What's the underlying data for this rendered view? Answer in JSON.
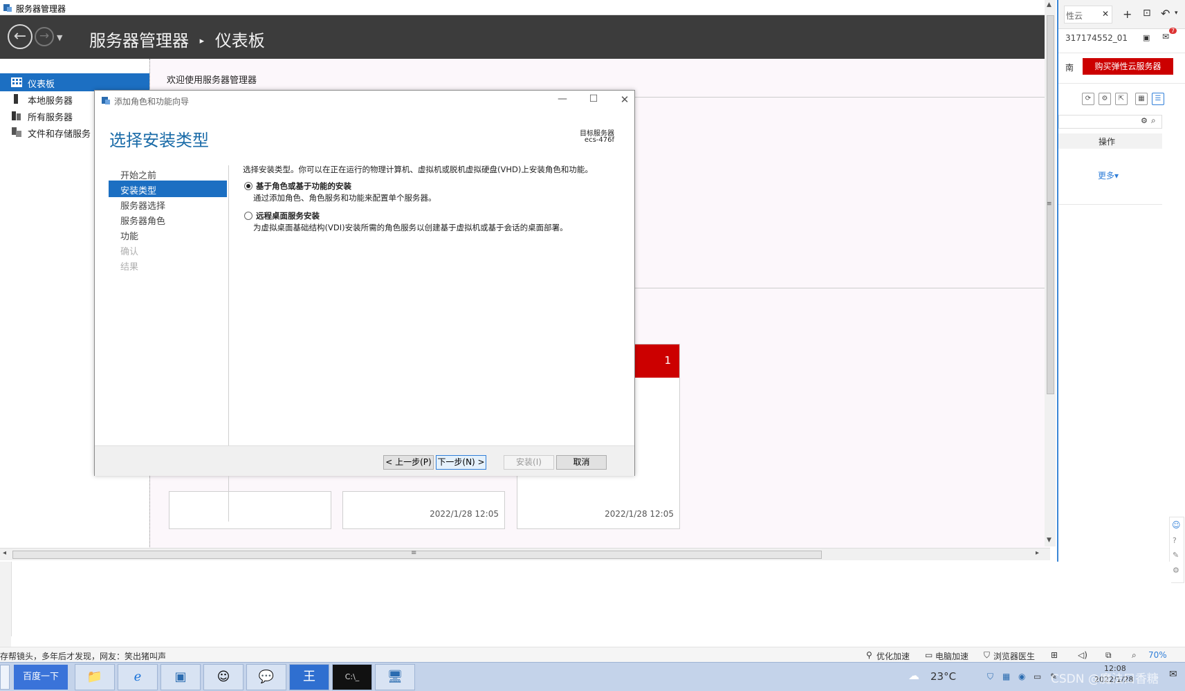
{
  "window": {
    "title": "服务器管理器",
    "breadcrumb_app": "服务器管理器",
    "breadcrumb_sep": "▸",
    "breadcrumb_page": "仪表板"
  },
  "sidebar": {
    "items": [
      {
        "label": "仪表板",
        "icon": "dashboard-icon",
        "active": true
      },
      {
        "label": "本地服务器",
        "icon": "server-icon",
        "active": false
      },
      {
        "label": "所有服务器",
        "icon": "servers-icon",
        "active": false
      },
      {
        "label": "文件和存储服务",
        "icon": "storage-icon",
        "active": false
      }
    ]
  },
  "main": {
    "welcome": "欢迎使用服务器管理器",
    "tile_badge": "1",
    "tiles": [
      {
        "timestamp": ""
      },
      {
        "timestamp": "2022/1/28 12:05"
      },
      {
        "timestamp": "2022/1/28 12:05"
      }
    ]
  },
  "dialog": {
    "title": "添加角色和功能向导",
    "headline": "选择安装类型",
    "target_label": "目标服务器",
    "target_value": "ecs-476f",
    "steps": [
      {
        "label": "开始之前",
        "state": "enabled"
      },
      {
        "label": "安装类型",
        "state": "active"
      },
      {
        "label": "服务器选择",
        "state": "enabled"
      },
      {
        "label": "服务器角色",
        "state": "enabled"
      },
      {
        "label": "功能",
        "state": "enabled"
      },
      {
        "label": "确认",
        "state": "disabled"
      },
      {
        "label": "结果",
        "state": "disabled"
      }
    ],
    "intro": "选择安装类型。你可以在正在运行的物理计算机、虚拟机或脱机虚拟硬盘(VHD)上安装角色和功能。",
    "options": [
      {
        "title": "基于角色或基于功能的安装",
        "desc": "通过添加角色、角色服务和功能来配置单个服务器。",
        "selected": true
      },
      {
        "title": "远程桌面服务安装",
        "desc": "为虚拟桌面基础结构(VDI)安装所需的角色服务以创建基于虚拟机或基于会话的桌面部署。",
        "selected": false
      }
    ],
    "buttons": {
      "prev": "< 上一步(P)",
      "next": "下一步(N) >",
      "install": "安装(I)",
      "cancel": "取消"
    }
  },
  "browser": {
    "tab_fragment": "性云",
    "account": "317174552_01",
    "guide_fragment": "南",
    "buy_button": "购买弹性云服务器",
    "actions_header": "操作",
    "more_link": "更多▾",
    "notification_count": "7"
  },
  "statusbar": {
    "news": "存帮镜头，多年后才发现，网友：笑出猪叫声",
    "optimize": "优化加速",
    "pc_speed": "电脑加速",
    "browser_doctor": "浏览器医生",
    "zoom": "70%"
  },
  "taskbar": {
    "baidu": "百度一下",
    "temperature": "23°C",
    "time": "12:08",
    "date": "2022/1/28",
    "watermark": "CSDN @魔法口香糖"
  },
  "colors": {
    "accent": "#1c6fc2",
    "header": "#3c3c3c",
    "badge_red": "#cc0000",
    "headline_blue": "#1a6ba8"
  }
}
